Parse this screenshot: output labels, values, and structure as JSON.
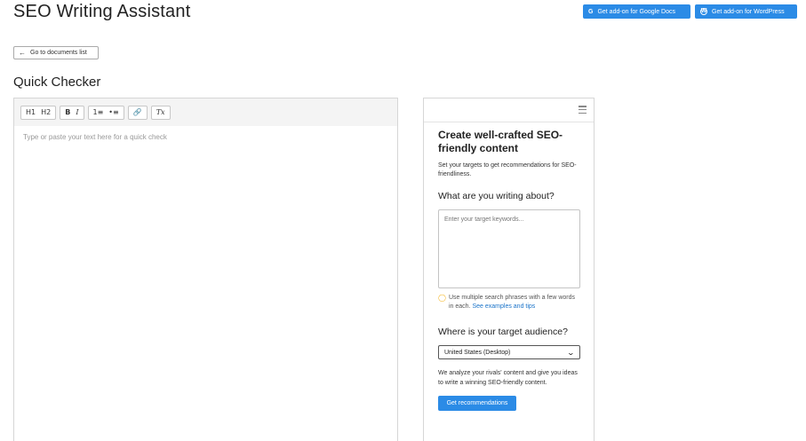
{
  "header": {
    "title": "SEO Writing Assistant",
    "gdocs_icon": "G",
    "gdocs_label": "Get add-on for Google Docs",
    "wp_icon": "W",
    "wp_label": "Get add-on for WordPress"
  },
  "nav": {
    "back_label": "Go to documents list"
  },
  "checker": {
    "title": "Quick Checker",
    "placeholder": "Type or paste your text here for a quick check",
    "toolbar": {
      "h1": "H1",
      "h2": "H2",
      "bold": "B",
      "italic": "I",
      "ordered_list": "1≡",
      "bullet_list": "•≡",
      "link": "🔗",
      "clear_format": "Tx"
    }
  },
  "panel": {
    "title": "Create well-crafted SEO-friendly content",
    "subtitle": "Set your targets to get recommendations for SEO-friendliness.",
    "question_keywords": "What are you writing about?",
    "keywords_placeholder": "Enter your target keywords...",
    "hint_text": "Use multiple search phrases with a few words in each.",
    "hint_link": "See examples and tips",
    "question_audience": "Where is your target audience?",
    "audience_selected": "United States (Desktop)",
    "analyze_text": "We analyze your rivals' content and give you ideas to write a winning SEO-friendly content.",
    "button_label": "Get recommendations"
  },
  "colors": {
    "accent": "#2b8be6",
    "link": "#1a73c9",
    "bulb": "#f5b623"
  },
  "icons": [
    "arrow-left-icon",
    "google-docs-icon",
    "wordpress-icon",
    "menu-icon",
    "bulb-icon",
    "chevron-down-icon",
    "link-icon",
    "clear-format-icon"
  ]
}
